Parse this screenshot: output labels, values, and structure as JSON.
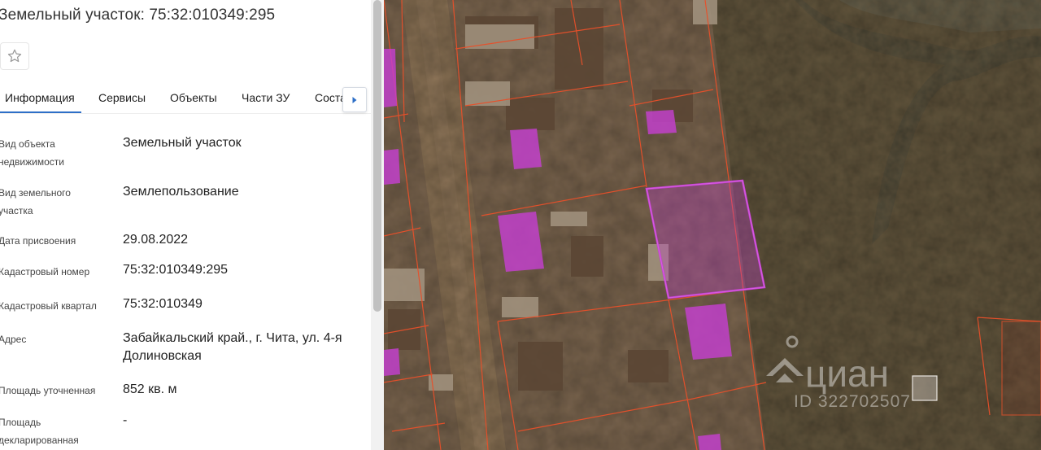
{
  "header": {
    "title": "Земельный участок: 75:32:010349:295"
  },
  "icons": {
    "favorite": "star-outline-icon",
    "tabs_next": "chevron-right-icon"
  },
  "tabs": [
    {
      "label": "Информация",
      "active": true
    },
    {
      "label": "Сервисы",
      "active": false
    },
    {
      "label": "Объекты",
      "active": false
    },
    {
      "label": "Части ЗУ",
      "active": false
    },
    {
      "label": "Состав",
      "active": false
    }
  ],
  "info": [
    {
      "label": "Вид объекта недвижимости",
      "value": "Земельный участок"
    },
    {
      "label": "Вид земельного участка",
      "value": "Землепользование"
    },
    {
      "label": "Дата присвоения",
      "value": "29.08.2022"
    },
    {
      "label": "Кадастровый номер",
      "value": "75:32:010349:295"
    },
    {
      "label": "Кадастровый квартал",
      "value": "75:32:010349"
    },
    {
      "label": "Адрес",
      "value": "Забайкальский край., г. Чита, ул. 4-я Долиновская"
    },
    {
      "label": "Площадь уточненная",
      "value": "852 кв. м"
    },
    {
      "label": "Площадь декларированная",
      "value": "-"
    }
  ],
  "map": {
    "watermark_brand": "циан",
    "watermark_id": "ID 322702507"
  },
  "colors": {
    "accent": "#2e6fc7",
    "parcel_border": "#e8502a",
    "building": "#c43fd0"
  }
}
